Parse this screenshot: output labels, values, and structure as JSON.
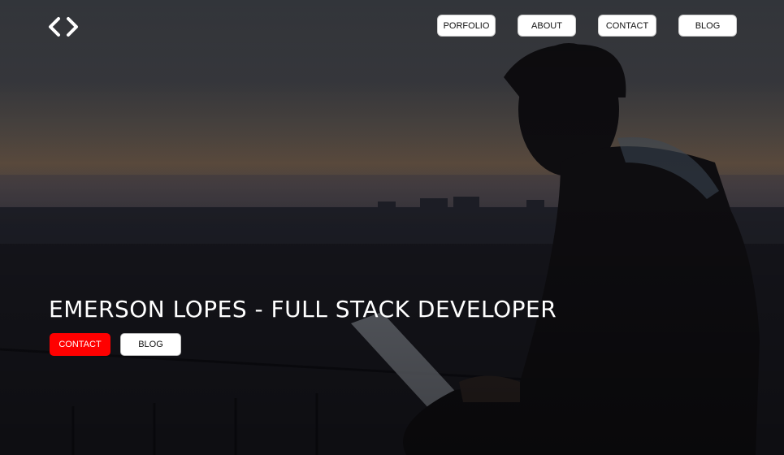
{
  "logo": {
    "icon": "code-brackets-icon",
    "color": "#ffffff"
  },
  "nav": {
    "items": [
      {
        "label": "PORFOLIO"
      },
      {
        "label": "ABOUT"
      },
      {
        "label": "CONTACT"
      },
      {
        "label": "BLOG"
      }
    ]
  },
  "hero": {
    "title": "EMERSON LOPES - FULL STACK DEVELOPER",
    "primary_cta": "CONTACT",
    "secondary_cta": "BLOG"
  },
  "colors": {
    "accent": "#ff0000",
    "text": "#ffffff",
    "button_bg": "#ffffff"
  }
}
